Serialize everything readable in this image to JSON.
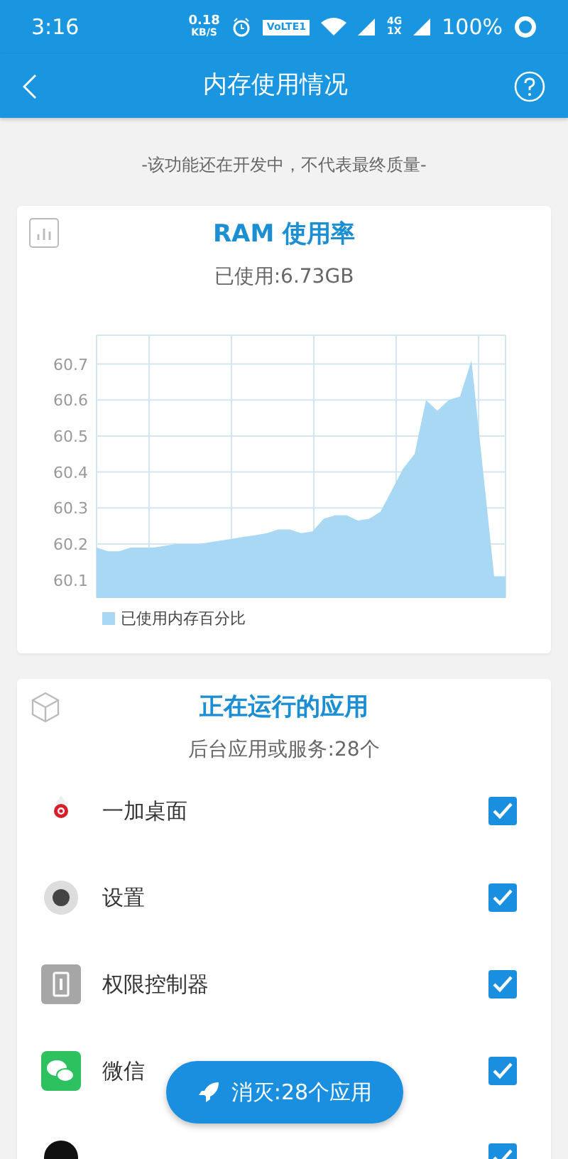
{
  "status_bar": {
    "time": "3:16",
    "speed": "0.18",
    "speed_unit": "KB/S",
    "volte": "VoLTE1",
    "net_top": "4G",
    "net_bottom": "1X",
    "battery": "100%"
  },
  "header": {
    "title": "内存使用情况"
  },
  "notice": "-该功能还在开发中，不代表最终质量-",
  "ram_card": {
    "title": "RAM 使用率",
    "used": "已使用:6.73GB",
    "chart_data": {
      "type": "area",
      "grid": true,
      "ylim": [
        60.05,
        60.78
      ],
      "yticks": [
        60.1,
        60.2,
        60.3,
        60.4,
        60.5,
        60.6,
        60.7
      ],
      "series": [
        {
          "name": "已使用内存百分比",
          "color": "#a8d8f4",
          "values": [
            60.19,
            60.18,
            60.18,
            60.19,
            60.19,
            60.19,
            60.195,
            60.2,
            60.2,
            60.2,
            60.205,
            60.21,
            60.215,
            60.22,
            60.225,
            60.23,
            60.24,
            60.24,
            60.23,
            60.235,
            60.27,
            60.28,
            60.28,
            60.265,
            60.27,
            60.29,
            60.35,
            60.41,
            60.45,
            60.6,
            60.57,
            60.6,
            60.61,
            60.71,
            60.41,
            60.11,
            60.11
          ]
        }
      ]
    }
  },
  "apps_card": {
    "title": "正在运行的应用",
    "subtitle": "后台应用或服务:28个",
    "apps": [
      {
        "name": "一加桌面",
        "kind": "launcher",
        "checked": true
      },
      {
        "name": "设置",
        "kind": "settings",
        "checked": true
      },
      {
        "name": "权限控制器",
        "kind": "permission",
        "checked": true
      },
      {
        "name": "微信",
        "kind": "wechat",
        "checked": true
      },
      {
        "kind": "dark",
        "checked": true
      }
    ]
  },
  "action_button": {
    "label": "消灭:28个应用"
  }
}
